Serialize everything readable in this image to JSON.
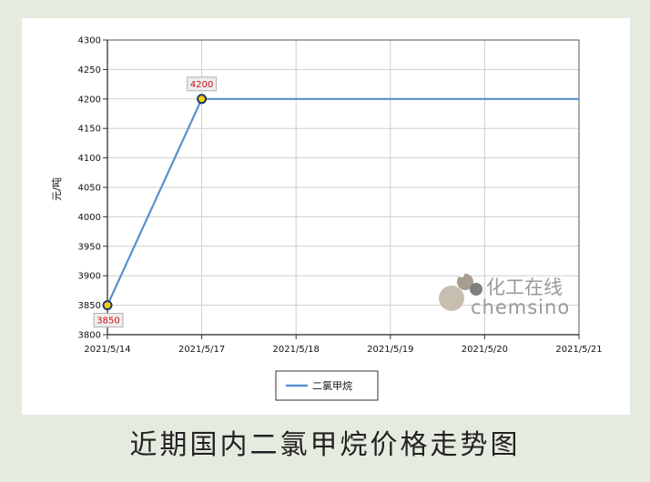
{
  "caption": "近期国内二氯甲烷价格走势图",
  "watermark": {
    "cn": "化工在线",
    "en": "chemsino"
  },
  "legend": {
    "label": "二氯甲烷"
  },
  "colors": {
    "line": "#5a8fd0",
    "marker_fill": "#f5d000",
    "marker_stroke": "#1f3a6e",
    "label_text": "#cc1111",
    "grid": "#cfcfcf"
  },
  "chart_data": {
    "type": "line",
    "categories": [
      "2021/5/14",
      "2021/5/17",
      "2021/5/18",
      "2021/5/19",
      "2021/5/20",
      "2021/5/21"
    ],
    "yticks": [
      "3800",
      "3850",
      "3900",
      "3950",
      "4000",
      "4050",
      "4100",
      "4150",
      "4200",
      "4250",
      "4300"
    ],
    "ylim": [
      3800,
      4300
    ],
    "ylabel": "元/吨",
    "xlabel": "",
    "grid": true,
    "legend_position": "bottom-center",
    "series": [
      {
        "name": "二氯甲烷",
        "values": [
          3850,
          4200,
          4200,
          4200,
          4200,
          4200
        ]
      }
    ],
    "data_labels": [
      {
        "index": 0,
        "text": "3850"
      },
      {
        "index": 1,
        "text": "4200"
      }
    ]
  }
}
